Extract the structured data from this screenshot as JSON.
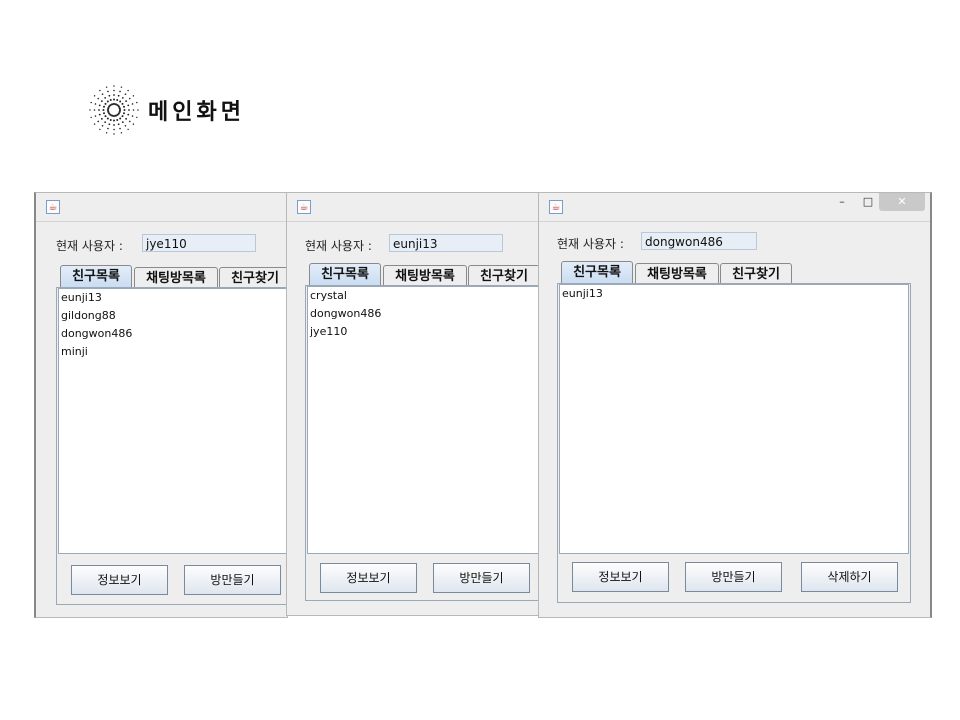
{
  "slide": {
    "title": "메인화면"
  },
  "windows": [
    {
      "user_label": "현재 사용자 :",
      "user_value": "jye110",
      "tabs": [
        "친구목록",
        "채팅방목록",
        "친구찾기"
      ],
      "friends": [
        "eunji13",
        "gildong88",
        "dongwon486",
        "minji"
      ],
      "buttons": [
        "정보보기",
        "방만들기"
      ]
    },
    {
      "user_label": "현재 사용자 :",
      "user_value": "eunji13",
      "tabs": [
        "친구목록",
        "채팅방목록",
        "친구찾기"
      ],
      "friends": [
        "crystal",
        "dongwon486",
        "jye110"
      ],
      "buttons": [
        "정보보기",
        "방만들기"
      ]
    },
    {
      "user_label": "현재 사용자 :",
      "user_value": "dongwon486",
      "tabs": [
        "친구목록",
        "채팅방목록",
        "친구찾기"
      ],
      "friends": [
        "eunji13"
      ],
      "buttons": [
        "정보보기",
        "방만들기",
        "삭제하기"
      ],
      "window_controls": {
        "minimize": "–",
        "maximize": "□",
        "close": "✕"
      }
    }
  ],
  "icons": {
    "app_icon": "java-cup-icon",
    "logo": "dotted-starburst-logo"
  }
}
